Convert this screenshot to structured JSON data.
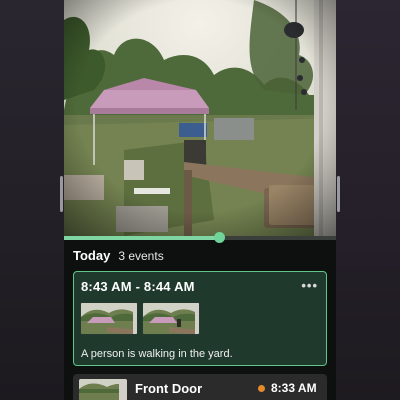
{
  "player": {
    "progress_percent": 57,
    "scene": "security camera view of a backyard with a pink canopy tent, string decorations and a wooden railing"
  },
  "events_header": {
    "title": "Today",
    "count": "3 events"
  },
  "active_event": {
    "time_range": "8:43 AM - 8:44 AM",
    "more_icon": "more-dots-icon",
    "description": "A person is walking in the yard."
  },
  "next_event": {
    "camera": "Front Door",
    "time": "8:33 AM",
    "status_color": "#e58a2a"
  },
  "colors": {
    "accent": "#5fc58a",
    "card_bg": "#1f3a2d"
  }
}
